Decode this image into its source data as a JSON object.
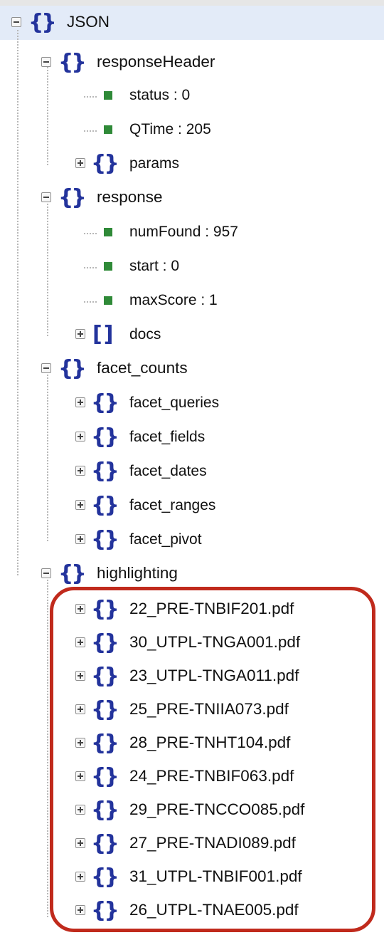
{
  "tree": {
    "root": {
      "label": "JSON",
      "icon": "curly-braces-icon",
      "expanded": true
    },
    "response_header": {
      "label": "responseHeader",
      "expanded": true,
      "status": "status : 0",
      "qtime": "QTime : 205",
      "params": "params"
    },
    "response": {
      "label": "response",
      "expanded": true,
      "num_found": "numFound : 957",
      "start": "start : 0",
      "max_score": "maxScore : 1",
      "docs": "docs"
    },
    "facet_counts": {
      "label": "facet_counts",
      "expanded": true,
      "children": [
        "facet_queries",
        "facet_fields",
        "facet_dates",
        "facet_ranges",
        "facet_pivot"
      ]
    },
    "highlighting": {
      "label": "highlighting",
      "expanded": true,
      "children": [
        "22_PRE-TNBIF201.pdf",
        "30_UTPL-TNGA001.pdf",
        "23_UTPL-TNGA011.pdf",
        "25_PRE-TNIIA073.pdf",
        "28_PRE-TNHT104.pdf",
        "24_PRE-TNBIF063.pdf",
        "29_PRE-TNCCO085.pdf",
        "27_PRE-TNADI089.pdf",
        "31_UTPL-TNBIF001.pdf",
        "26_UTPL-TNAE005.pdf"
      ]
    }
  },
  "colors": {
    "icon": "#23339c",
    "leaf": "#2f8a38",
    "highlight_row": "#e3ebf8",
    "callout_border": "#c02a1c"
  }
}
